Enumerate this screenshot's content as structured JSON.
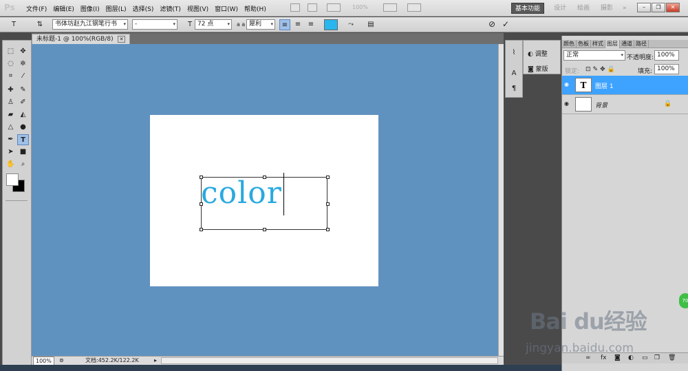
{
  "app": {
    "logo": "Ps"
  },
  "menu": [
    "文件(F)",
    "编辑(E)",
    "图像(I)",
    "图层(L)",
    "选择(S)",
    "滤镜(T)",
    "视图(V)",
    "窗口(W)",
    "帮助(H)"
  ],
  "menubar": {
    "zoom": "100%",
    "workspace_active": "基本功能",
    "workspace_others": [
      "设计",
      "绘画",
      "摄影"
    ],
    "more": "»"
  },
  "options": {
    "font_family": "书体坊赵九江钢笔行书",
    "font_style": "-",
    "font_size": "72 点",
    "antialias_label": "a a",
    "antialias": "犀利",
    "text_color": "#29b6ee"
  },
  "document": {
    "tab_title": "未标题-1 @ 100%(RGB/8)",
    "close": "✕",
    "text": "color",
    "status_zoom": "100%",
    "status_doc": "文档:452.2K/122.2K",
    "canvas_bg": "#6092c0"
  },
  "adjust": {
    "items": [
      "调整",
      "蒙版"
    ]
  },
  "panel": {
    "tabs": [
      "颜色",
      "色板",
      "样式",
      "图层",
      "通道",
      "路径"
    ],
    "blend_mode": "正常",
    "opacity_label": "不透明度:",
    "opacity": "100%",
    "lock_label": "锁定:",
    "fill_label": "填充:",
    "fill": "100%",
    "layers": [
      {
        "name": "图层 1",
        "thumb": "T",
        "selected": true
      },
      {
        "name": "背景",
        "thumb": "",
        "selected": false
      }
    ],
    "bottom_icons": [
      "link-icon",
      "fx-icon",
      "mask-icon",
      "adjust-icon",
      "folder-icon",
      "new-layer-icon",
      "trash-icon"
    ]
  },
  "watermark": {
    "brand": "Bai  du",
    "brand_cn": "经验",
    "url": "jingyan.baidu.com",
    "badge": "70"
  }
}
